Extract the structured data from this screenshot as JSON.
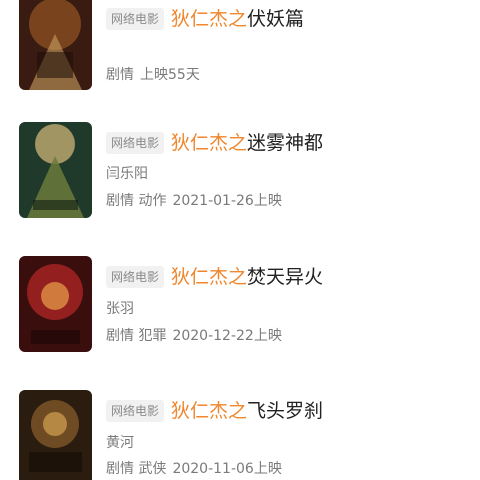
{
  "items": [
    {
      "tag": "网络电影",
      "title_highlight": "狄仁杰之",
      "title_rest": "伏妖篇",
      "director": "",
      "genre": "剧情",
      "info": "上映55天",
      "colors": [
        "#3a1b12",
        "#8a4d22",
        "#c8a060"
      ]
    },
    {
      "tag": "网络电影",
      "title_highlight": "狄仁杰之",
      "title_rest": "迷雾神都",
      "director": "闫乐阳",
      "genre": "剧情 动作",
      "info": "2021-01-26上映",
      "colors": [
        "#1f3a2a",
        "#6b7a3c",
        "#cdb477"
      ]
    },
    {
      "tag": "网络电影",
      "title_highlight": "狄仁杰之",
      "title_rest": "焚天异火",
      "director": "张羽",
      "genre": "剧情 犯罪",
      "info": "2020-12-22上映",
      "colors": [
        "#3b0e0e",
        "#a32222",
        "#e9a24a"
      ]
    },
    {
      "tag": "网络电影",
      "title_highlight": "狄仁杰之",
      "title_rest": "飞头罗刹",
      "director": "黄河",
      "genre": "剧情 武侠",
      "info": "2020-11-06上映",
      "colors": [
        "#2b1c10",
        "#7a5326",
        "#e4b25a"
      ]
    }
  ]
}
